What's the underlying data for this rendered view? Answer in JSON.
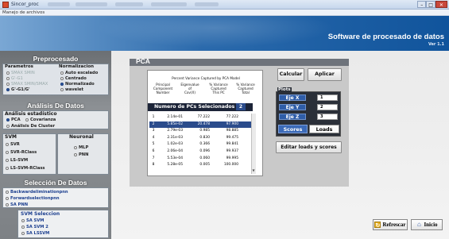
{
  "window": {
    "title": "Sincor_proc",
    "controls": [
      "–",
      "□",
      "✕"
    ]
  },
  "menubar": {
    "item": "Manejo de archivos"
  },
  "banner": {
    "title": "Software de procesado de datos",
    "version": "Ver 1.1"
  },
  "preprocesado": {
    "heading": "Preprocesado",
    "parametros_label": "Parametros",
    "normalizacion_label": "Normalizacion",
    "parametros": [
      {
        "label": "SMAX SMIN",
        "selected": false,
        "enabled": false
      },
      {
        "label": "G'-G1",
        "selected": false,
        "enabled": false
      },
      {
        "label": "SMAX SMIN/SMAX",
        "selected": false,
        "enabled": false
      },
      {
        "label": "G'-G1/G'",
        "selected": true,
        "enabled": true
      }
    ],
    "normalizacion": [
      {
        "label": "Auto escalado",
        "selected": false
      },
      {
        "label": "Centrado",
        "selected": false
      },
      {
        "label": "Normalizado",
        "selected": true
      },
      {
        "label": "wavelet",
        "selected": false
      }
    ]
  },
  "analisis": {
    "heading": "Análisis De Datos",
    "estadistico_label": "Análisis estadístico",
    "estadistico": [
      {
        "label": "PCA",
        "selected": true
      },
      {
        "label": "Covarianza",
        "selected": false
      }
    ],
    "cluster_label": "Análisis De Cluster",
    "svm_label": "SVM",
    "neuronal_label": "Neuronal",
    "svm": [
      "SVR",
      "SVR-RClass",
      "LS-SVM",
      "LS-SVM-RClass"
    ],
    "neuronal": [
      "MLP",
      "PNN"
    ]
  },
  "seleccion": {
    "heading": "Selección De Datos",
    "options": [
      "Backwardeliminationpnn",
      "Forwardselectionpnn",
      "SA PNN"
    ],
    "svm_heading": "SVM Seleccion",
    "svm_options": [
      "SA SVM",
      "SA SVM 2",
      "SA LSSVM"
    ]
  },
  "pca": {
    "title": "PCA",
    "table_caption": "Percent Variance Captured by PCA Model",
    "headers": [
      [
        "Principal",
        "Component",
        "Number"
      ],
      [
        "Eigenvalue",
        "of",
        "Cov(X)"
      ],
      [
        "% Variance",
        "Captured",
        "This PC"
      ],
      [
        "% Variance",
        "Captured",
        "Total"
      ]
    ],
    "num_pcs_label": "Numero de PCs Selecionados",
    "num_pcs_value": "2",
    "rows": [
      [
        "1",
        "2.14e-01",
        "77.222",
        "77.222"
      ],
      [
        "2",
        "5.85e-02",
        "20.478",
        "97.900"
      ],
      [
        "3",
        "2.79e-03",
        "0.985",
        "98.885"
      ],
      [
        "4",
        "2.31e-03",
        "0.830",
        "99.475"
      ],
      [
        "5",
        "1.02e-03",
        "0.366",
        "99.841"
      ],
      [
        "6",
        "2.06e-04",
        "0.096",
        "99.937"
      ],
      [
        "7",
        "5.53e-04",
        "0.060",
        "99.995"
      ],
      [
        "8",
        "5.28e-05",
        "0.005",
        "100.000"
      ]
    ]
  },
  "actions": {
    "calcular": "Calcular",
    "aplicar": "Aplicar"
  },
  "plots": {
    "label": "Plots",
    "ejes": [
      {
        "label": "Eje X",
        "value": "1"
      },
      {
        "label": "Eje Y",
        "value": "2"
      },
      {
        "label": "Eje Z",
        "value": "3"
      }
    ],
    "scores": "Scores",
    "loads": "Loads",
    "editar": "Editar loads y scores"
  },
  "footer": {
    "refrescar": "Refrescar",
    "inicio": "Inicio"
  }
}
